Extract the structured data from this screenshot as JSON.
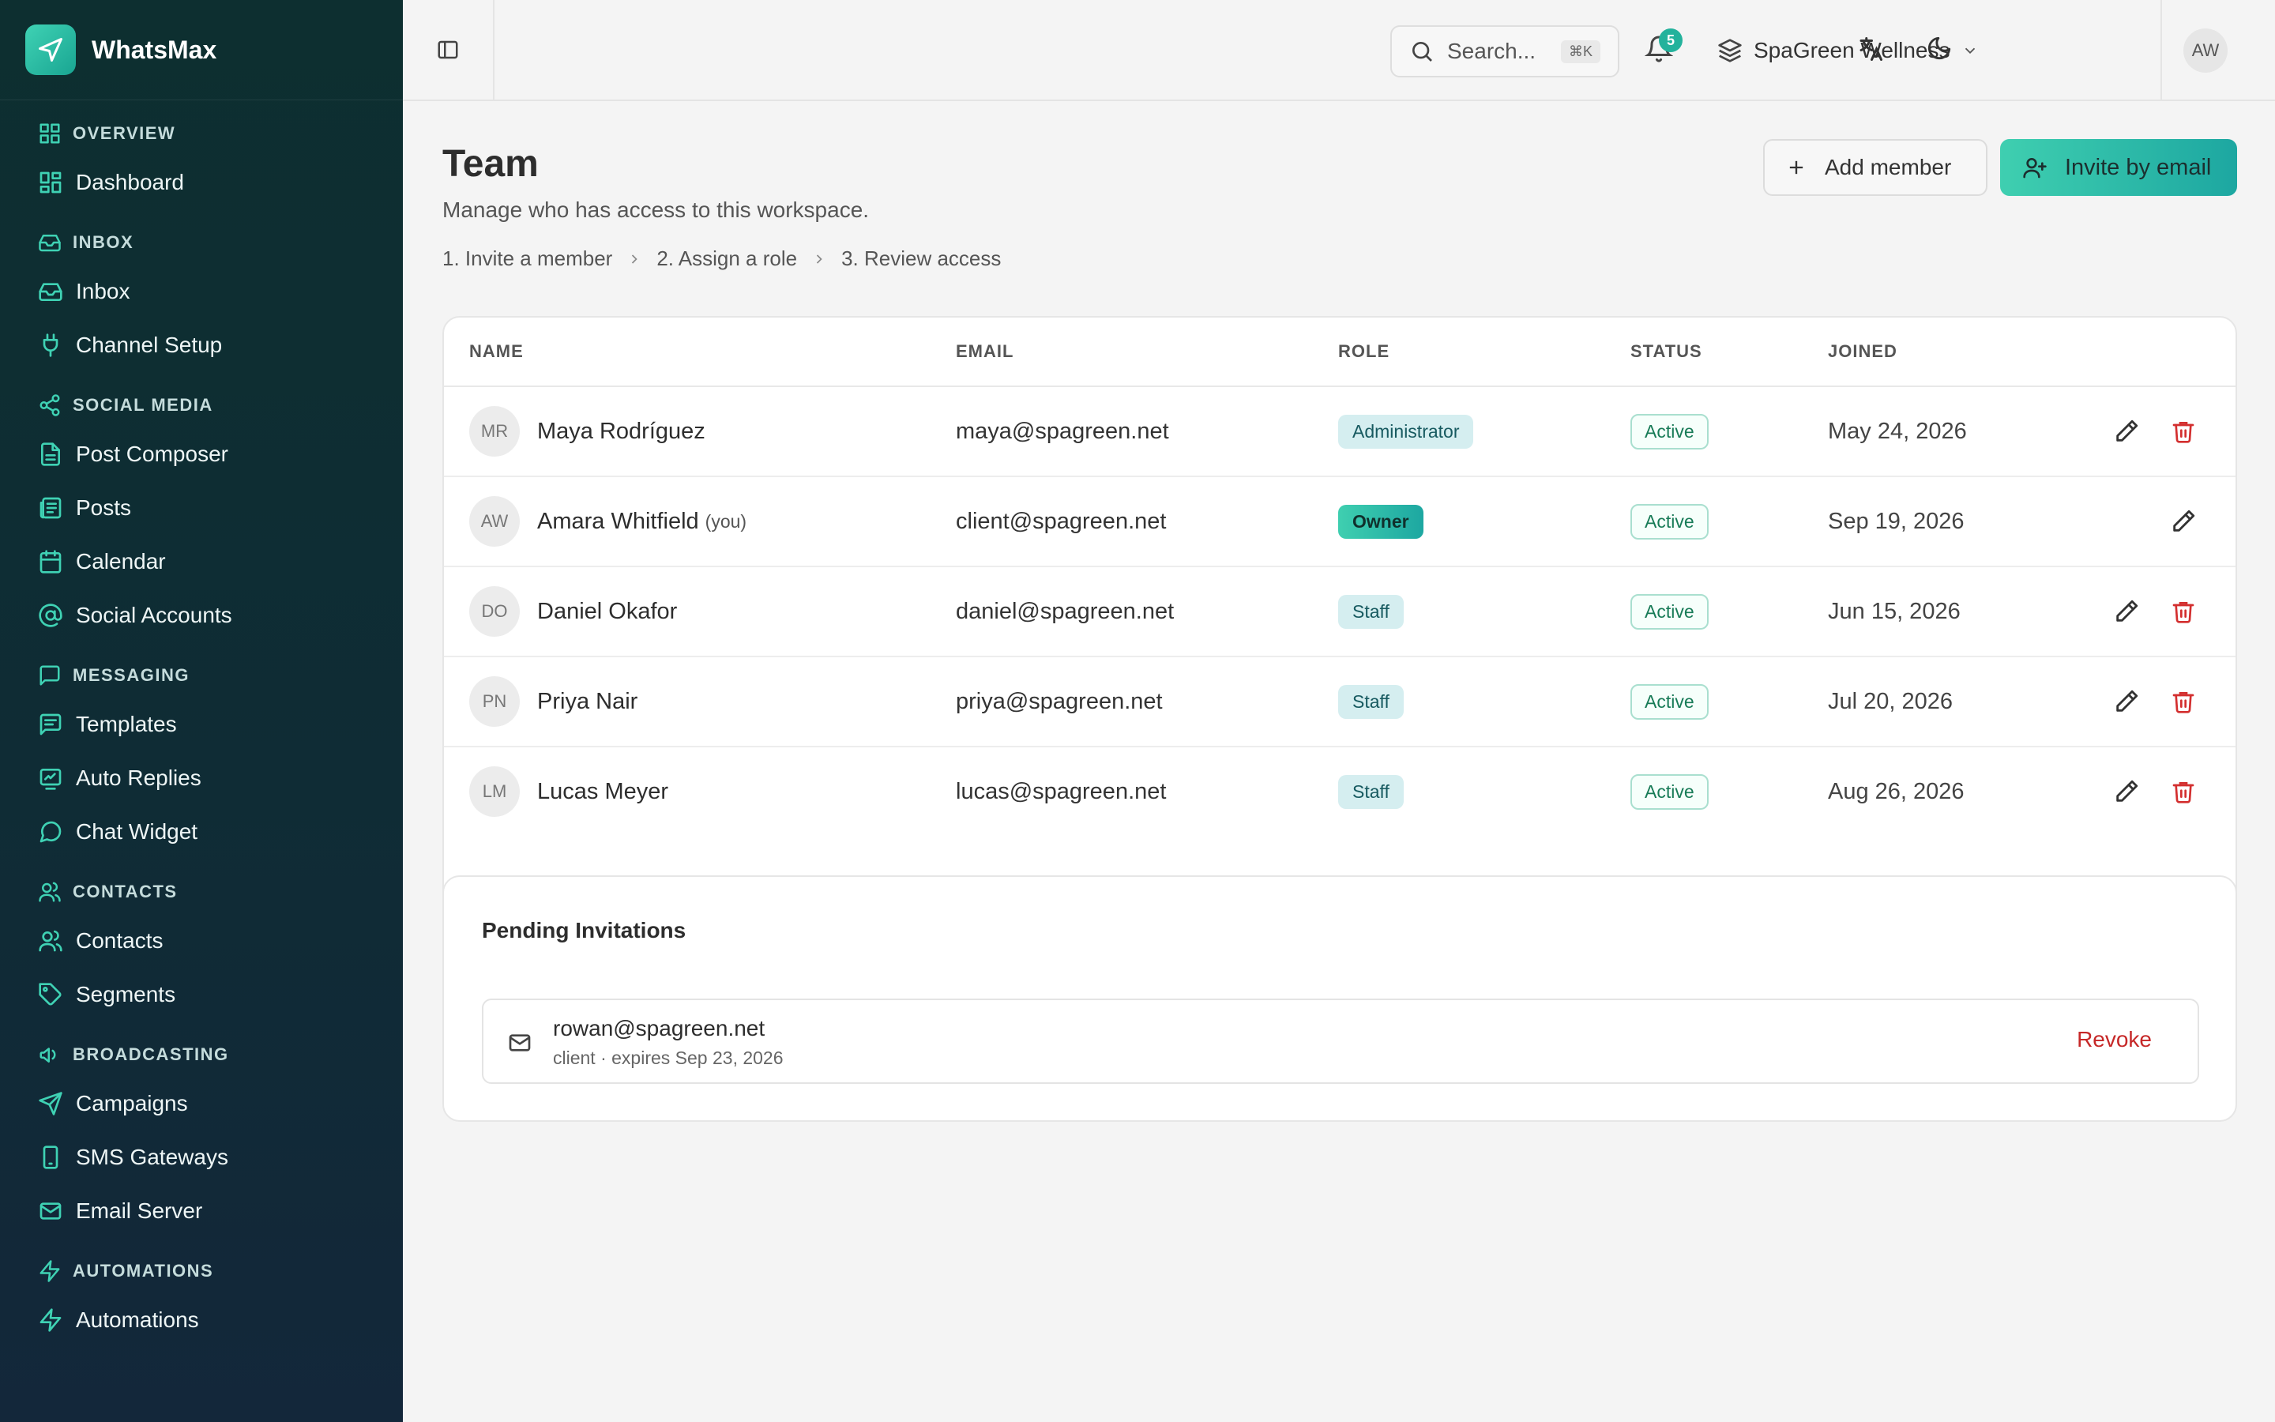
{
  "app": {
    "name": "WhatsMax"
  },
  "sidebar": {
    "sections": [
      {
        "title": "OVERVIEW",
        "icon": "grid-icon",
        "items": [
          {
            "label": "Dashboard",
            "icon": "dashboard-icon"
          }
        ]
      },
      {
        "title": "INBOX",
        "icon": "inbox-icon",
        "items": [
          {
            "label": "Inbox",
            "icon": "inbox-icon"
          },
          {
            "label": "Channel Setup",
            "icon": "plug-icon"
          }
        ]
      },
      {
        "title": "SOCIAL MEDIA",
        "icon": "share-icon",
        "items": [
          {
            "label": "Post Composer",
            "icon": "file-text-icon"
          },
          {
            "label": "Posts",
            "icon": "newspaper-icon"
          },
          {
            "label": "Calendar",
            "icon": "calendar-icon"
          },
          {
            "label": "Social Accounts",
            "icon": "at-sign-icon"
          }
        ]
      },
      {
        "title": "MESSAGING",
        "icon": "message-square-icon",
        "items": [
          {
            "label": "Templates",
            "icon": "message-text-icon"
          },
          {
            "label": "Auto Replies",
            "icon": "bot-icon"
          },
          {
            "label": "Chat Widget",
            "icon": "message-circle-icon"
          }
        ]
      },
      {
        "title": "CONTACTS",
        "icon": "users-icon",
        "items": [
          {
            "label": "Contacts",
            "icon": "users-icon"
          },
          {
            "label": "Segments",
            "icon": "tag-icon"
          }
        ]
      },
      {
        "title": "BROADCASTING",
        "icon": "megaphone-icon",
        "items": [
          {
            "label": "Campaigns",
            "icon": "send-icon"
          },
          {
            "label": "SMS Gateways",
            "icon": "smartphone-icon"
          },
          {
            "label": "Email Server",
            "icon": "mail-icon"
          }
        ]
      },
      {
        "title": "AUTOMATIONS",
        "icon": "zap-icon",
        "items": [
          {
            "label": "Automations",
            "icon": "zap-icon"
          }
        ]
      }
    ]
  },
  "topbar": {
    "search_placeholder": "Search...",
    "search_shortcut": "⌘K",
    "notification_count": "5",
    "workspace": "SpaGreen Wellness",
    "user_initials": "AW"
  },
  "page": {
    "title": "Team",
    "subtitle": "Manage who has access to this workspace.",
    "steps": [
      "1.  Invite a member",
      "2.  Assign a role",
      "3.  Review access"
    ],
    "add_member_label": "Add member",
    "invite_label": "Invite by email"
  },
  "table": {
    "headers": {
      "name": "NAME",
      "email": "EMAIL",
      "role": "ROLE",
      "status": "STATUS",
      "joined": "JOINED"
    },
    "rows": [
      {
        "initials": "MR",
        "name": "Maya Rodríguez",
        "you": "",
        "email": "maya@spagreen.net",
        "role": "Administrator",
        "status": "Active",
        "joined": "May 24, 2026",
        "deletable": true
      },
      {
        "initials": "AW",
        "name": "Amara Whitfield",
        "you": "(you)",
        "email": "client@spagreen.net",
        "role": "Owner",
        "status": "Active",
        "joined": "Sep 19, 2026",
        "deletable": false
      },
      {
        "initials": "DO",
        "name": "Daniel Okafor",
        "you": "",
        "email": "daniel@spagreen.net",
        "role": "Staff",
        "status": "Active",
        "joined": "Jun 15, 2026",
        "deletable": true
      },
      {
        "initials": "PN",
        "name": "Priya Nair",
        "you": "",
        "email": "priya@spagreen.net",
        "role": "Staff",
        "status": "Active",
        "joined": "Jul 20, 2026",
        "deletable": true
      },
      {
        "initials": "LM",
        "name": "Lucas Meyer",
        "you": "",
        "email": "lucas@spagreen.net",
        "role": "Staff",
        "status": "Active",
        "joined": "Aug 26, 2026",
        "deletable": true
      }
    ]
  },
  "pending": {
    "title": "Pending Invitations",
    "items": [
      {
        "email": "rowan@spagreen.net",
        "meta": "client · expires Sep 23, 2026",
        "action": "Revoke"
      }
    ]
  },
  "colors": {
    "accent": "#23b29c",
    "danger": "#c62828",
    "sidebar_bg": "#0f2c35"
  }
}
